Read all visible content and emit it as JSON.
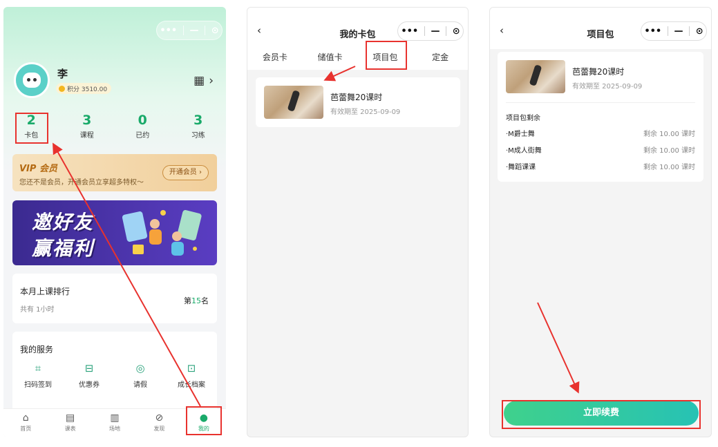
{
  "screen1": {
    "user_name": "李",
    "points_label": "积分 3510.00",
    "stats": [
      {
        "value": "2",
        "label": "卡包"
      },
      {
        "value": "3",
        "label": "课程"
      },
      {
        "value": "0",
        "label": "已约"
      },
      {
        "value": "3",
        "label": "习练"
      }
    ],
    "vip": {
      "title": "VIP 会员",
      "subtitle": "您还不是会员，开通会员立享超多特权～",
      "button": "开通会员 ›"
    },
    "banner": {
      "line1": "邀好友",
      "line2": "赢福利"
    },
    "ranking": {
      "title": "本月上课排行",
      "subtitle": "共有 1小时",
      "rank_prefix": "第",
      "rank_value": "15",
      "rank_suffix": "名"
    },
    "services": {
      "title": "我的服务",
      "items": [
        {
          "label": "扫码签到",
          "icon": "scan-icon"
        },
        {
          "label": "优惠券",
          "icon": "coupon-icon"
        },
        {
          "label": "请假",
          "icon": "leave-icon"
        },
        {
          "label": "成长档案",
          "icon": "archive-icon"
        }
      ]
    },
    "tabbar": [
      {
        "label": "首页",
        "icon": "home-icon"
      },
      {
        "label": "课表",
        "icon": "schedule-icon"
      },
      {
        "label": "场地",
        "icon": "venue-icon"
      },
      {
        "label": "发现",
        "icon": "compass-icon"
      },
      {
        "label": "我的",
        "icon": "profile-icon",
        "active": true
      }
    ]
  },
  "screen2": {
    "back": "‹",
    "title": "我的卡包",
    "tabs": [
      "会员卡",
      "储值卡",
      "项目包",
      "定金"
    ],
    "active_tab": "项目包",
    "package": {
      "name": "芭蕾舞20课时",
      "expiry": "有效期至 2025-09-09"
    }
  },
  "screen3": {
    "back": "‹",
    "title": "项目包",
    "package": {
      "name": "芭蕾舞20课时",
      "expiry": "有效期至 2025-09-09"
    },
    "remaining_title": "项目包剩余",
    "remaining": [
      {
        "name": "·M爵士舞",
        "value": "剩余 10.00 课时"
      },
      {
        "name": "·M成人街舞",
        "value": "剩余 10.00 课时"
      },
      {
        "name": "·舞蹈课课",
        "value": "剩余 10.00 课时"
      }
    ],
    "renew_button": "立即续费"
  },
  "capsule": {
    "more": "•••",
    "minimize": "—",
    "close": "⊙"
  },
  "colors": {
    "accent_green": "#1aaa6a",
    "annotation_red": "#e8322e",
    "renew_gradient_start": "#3fd18c",
    "renew_gradient_end": "#27c2b4"
  }
}
